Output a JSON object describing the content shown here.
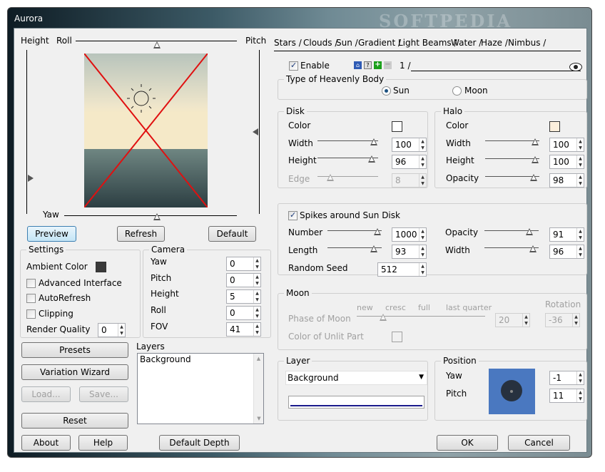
{
  "window": {
    "title": "Aurora",
    "watermark": "SOFTPEDIA"
  },
  "preview": {
    "height_label": "Height",
    "roll_label": "Roll",
    "pitch_label": "Pitch",
    "yaw_label": "Yaw"
  },
  "buttons": {
    "preview": "Preview",
    "refresh": "Refresh",
    "default": "Default",
    "presets": "Presets",
    "variation_wizard": "Variation Wizard",
    "load": "Load...",
    "save": "Save...",
    "reset": "Reset",
    "about": "About",
    "help": "Help",
    "default_depth": "Default Depth",
    "ok": "OK",
    "cancel": "Cancel"
  },
  "settings": {
    "title": "Settings",
    "ambient_color_label": "Ambient Color",
    "ambient_color": "#3a3a3a",
    "advanced_interface": "Advanced Interface",
    "autorefresh": "AutoRefresh",
    "clipping": "Clipping",
    "render_quality_label": "Render Quality",
    "render_quality": "0"
  },
  "camera": {
    "title": "Camera",
    "yaw_label": "Yaw",
    "yaw": "0",
    "pitch_label": "Pitch",
    "pitch": "0",
    "height_label": "Height",
    "height": "5",
    "roll_label": "Roll",
    "roll": "0",
    "fov_label": "FOV",
    "fov": "41"
  },
  "layers": {
    "title": "Layers",
    "items": [
      "Background"
    ]
  },
  "tabs": [
    "Stars",
    "Clouds",
    "Sun",
    "Gradient",
    "Light Beams",
    "Water",
    "Haze",
    "Nimbus"
  ],
  "active_tab": "Sun",
  "sun": {
    "enable_label": "Enable",
    "enabled": true,
    "page_tab": "1",
    "body_type": {
      "title": "Type of Heavenly Body",
      "sun": "Sun",
      "moon": "Moon",
      "selected": "Sun"
    },
    "disk": {
      "title": "Disk",
      "color_label": "Color",
      "color": "#ffffff",
      "width_label": "Width",
      "width": "100",
      "height_label": "Height",
      "height": "96",
      "edge_label": "Edge",
      "edge": "8"
    },
    "halo": {
      "title": "Halo",
      "color_label": "Color",
      "color": "#fcefdc",
      "width_label": "Width",
      "width": "100",
      "height_label": "Height",
      "height": "100",
      "opacity_label": "Opacity",
      "opacity": "98"
    },
    "spikes": {
      "label": "Spikes around Sun Disk",
      "enabled": true,
      "number_label": "Number",
      "number": "1000",
      "length_label": "Length",
      "length": "93",
      "random_seed_label": "Random Seed",
      "random_seed": "512",
      "opacity_label": "Opacity",
      "opacity": "91",
      "width_label": "Width",
      "width": "96"
    },
    "moon": {
      "title": "Moon",
      "phase_label": "Phase of Moon",
      "phase_marks": [
        "new",
        "cresc",
        "full",
        "last quarter"
      ],
      "phase": "20",
      "rotation_label": "Rotation",
      "rotation": "-36",
      "unlit_label": "Color of Unlit Part"
    },
    "layer": {
      "title": "Layer",
      "value": "Background",
      "line_color": "#1a1a8c"
    },
    "position": {
      "title": "Position",
      "yaw_label": "Yaw",
      "yaw": "-1",
      "pitch_label": "Pitch",
      "pitch": "11",
      "map_color": "#4a78c0"
    }
  }
}
